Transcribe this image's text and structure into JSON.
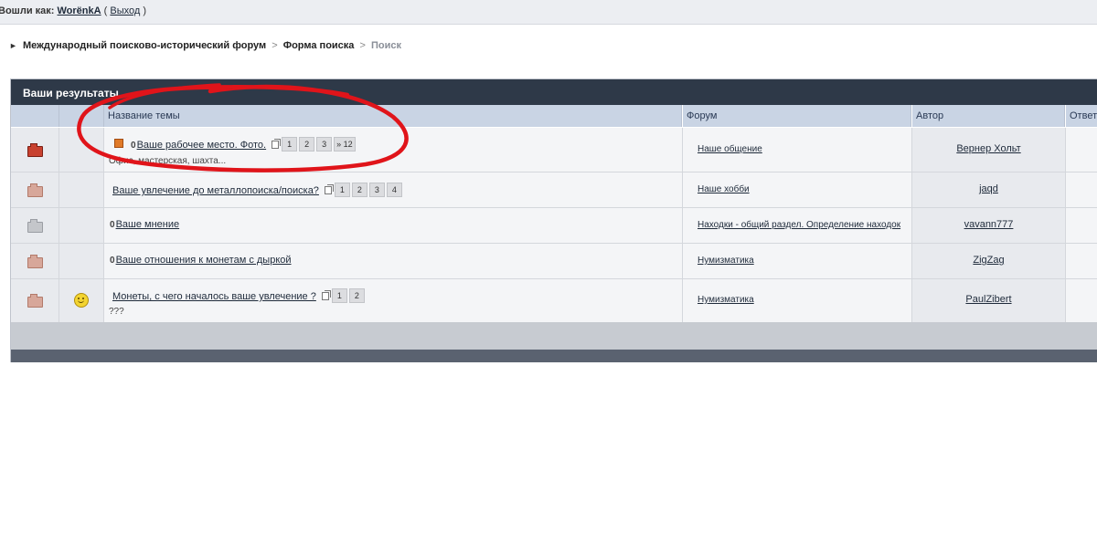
{
  "login": {
    "prefix": "Вошли как:",
    "user": "WorënkA",
    "open_paren": "(",
    "logout": "Выход",
    "close_paren": ")"
  },
  "breadcrumb": {
    "items": [
      "Международный поисково-исторический форум",
      "Форма поиска"
    ],
    "separator": ">",
    "current": "Поиск"
  },
  "results": {
    "title": "Ваши результаты",
    "columns": {
      "topic": "Название темы",
      "forum": "Форум",
      "author": "Автор",
      "replies": "Ответ"
    },
    "rows": [
      {
        "icon": "hot-folder-icon",
        "new": true,
        "clip": "0",
        "title": "Ваше рабочее место. Фото.",
        "pages": [
          "1",
          "2",
          "3",
          "» 12"
        ],
        "desc": "Офис, мастерская, шахта...",
        "forum": "Наше общение",
        "author": "Вернер Хольт"
      },
      {
        "icon": "folder-icon",
        "title": "Ваше увлечение до металлопоиска/поиска?",
        "pages": [
          "1",
          "2",
          "3",
          "4"
        ],
        "forum": "Наше хобби",
        "author": "jaqd"
      },
      {
        "icon": "locked-folder-icon",
        "clip": "0",
        "title": "Ваше мнение",
        "forum": "Находки - общий раздел. Определение находок",
        "author": "vavann777"
      },
      {
        "icon": "folder-icon",
        "clip": "0",
        "title": "Ваше отношения к монетам с дыркой",
        "forum": "Нумизматика",
        "author": "ZigZag"
      },
      {
        "icon": "folder-icon",
        "emoticon": "smiley-icon",
        "title": "Монеты, с чего началось ваше увлечение ?",
        "pages": [
          "1",
          "2"
        ],
        "desc": "???",
        "forum": "Нумизматика",
        "author": "PaulZibert"
      }
    ]
  },
  "colors": {
    "header_bg": "#2e3948",
    "column_header_bg": "#c9d4e4",
    "annotation": "#e0141a"
  }
}
